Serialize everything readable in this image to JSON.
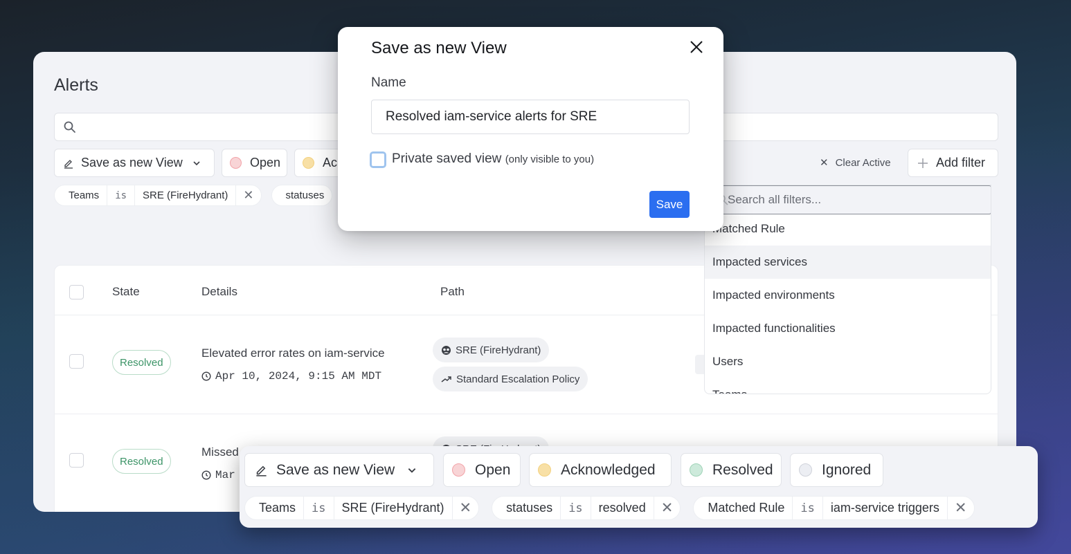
{
  "app": {
    "title": "Alerts",
    "search": {
      "placeholder": "",
      "value": ""
    },
    "toolbar": {
      "save_view_label": "Save as new View",
      "status_buttons": [
        {
          "label": "Open",
          "color": "#f8d4d6",
          "ring": "#f2a3a8"
        },
        {
          "label": "Acknowledged",
          "visible_label": "Ack",
          "color": "#f8e0a6",
          "ring": "#f3d17f"
        },
        {
          "label": "Resolved",
          "color": "#cdeadb",
          "ring": "#9fd3b7"
        },
        {
          "label": "Ignored",
          "color": "#eceef3",
          "ring": "#cfd2da"
        }
      ],
      "clear_active_label": "Clear Active",
      "add_filter_label": "Add filter"
    },
    "active_filters": [
      {
        "field": "Teams",
        "operator": "is",
        "value": "SRE (FireHydrant)"
      },
      {
        "field": "statuses",
        "operator": "is",
        "value": "resolved"
      },
      {
        "field": "Matched Rule",
        "operator": "is",
        "value": "iam-service triggers"
      }
    ],
    "table": {
      "columns": [
        "State",
        "Details",
        "Path"
      ],
      "rows": [
        {
          "state": "Resolved",
          "title": "Elevated error rates on iam-service",
          "time": "Apr 10, 2024, 9:15 AM MDT",
          "path": [
            {
              "icon": "team-icon",
              "label": "SRE (FireHydrant)"
            },
            {
              "icon": "escalation-icon",
              "label": "Standard Escalation Policy"
            }
          ]
        },
        {
          "state": "Resolved",
          "title": "Missed",
          "time": "Mar",
          "path": [
            {
              "icon": "team-icon",
              "label": "SRE (FireHydrant)"
            }
          ]
        }
      ]
    }
  },
  "filter_dropdown": {
    "search_placeholder": "Search all filters...",
    "items": [
      "Matched Rule",
      "Impacted services",
      "Impacted environments",
      "Impacted functionalities",
      "Users",
      "Teams"
    ],
    "hovered_index": 1
  },
  "modal": {
    "title": "Save as new View",
    "name_label": "Name",
    "name_value": "Resolved iam-service alerts for SRE",
    "private_label": "Private saved view",
    "private_hint": "(only visible to you)",
    "private_checked": false,
    "save_label": "Save"
  },
  "accent_color": "#2b6ef0"
}
